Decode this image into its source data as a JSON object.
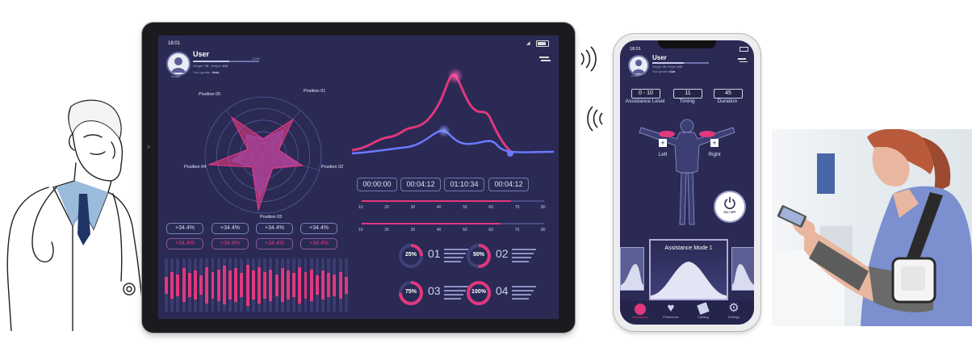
{
  "tablet": {
    "status_time": "18:01",
    "user": {
      "name": "User",
      "weight_label": "Weight:",
      "weight": "74",
      "height_label": "Height:",
      "height": "174",
      "gender_label": "Your gender:",
      "gender": "Male",
      "score": "12/50",
      "avatar_caption": "Avatar"
    },
    "radar": {
      "labels": [
        "Position 01",
        "Position 02",
        "Position 03",
        "Position 04",
        "Position 05"
      ],
      "series_blue": [
        0.55,
        0.62,
        0.75,
        0.55,
        0.45
      ],
      "series_pink": [
        0.8,
        0.7,
        0.95,
        0.95,
        0.85
      ]
    },
    "timers": [
      "00:00:00",
      "00:04:12",
      "01:10:34",
      "00:04:12"
    ],
    "slider_ticks": [
      "10",
      "20",
      "30",
      "40",
      "50",
      "60",
      "70",
      "80"
    ],
    "slider_values": [
      0.82,
      0.76
    ],
    "stats_row1": [
      "+34.4%",
      "+34.4%",
      "+34.4%",
      "+34.4%"
    ],
    "stats_row2": [
      "+34.4%",
      "+34.4%",
      "+34.4%",
      "+34.4%"
    ],
    "donuts": [
      {
        "value": "25%",
        "fraction": 0.25,
        "num": "01"
      },
      {
        "value": "50%",
        "fraction": 0.5,
        "num": "02"
      },
      {
        "value": "75%",
        "fraction": 0.75,
        "num": "03"
      },
      {
        "value": "100%",
        "fraction": 1.0,
        "num": "04"
      }
    ],
    "bar_levels": [
      0.35,
      0.55,
      0.45,
      0.7,
      0.5,
      0.6,
      0.4,
      0.75,
      0.55,
      0.65,
      0.8,
      0.6,
      0.7,
      0.5,
      0.85,
      0.6,
      0.75,
      0.55,
      0.65,
      0.45,
      0.7,
      0.6,
      0.5,
      0.75,
      0.55,
      0.65,
      0.4,
      0.6,
      0.5,
      0.45,
      0.55,
      0.35
    ]
  },
  "phone": {
    "status_time": "18:01",
    "user": {
      "name": "User",
      "weight_label": "Weight:",
      "weight": "74",
      "height_label": "Height:",
      "height": "174",
      "gender_label": "Your gender:",
      "gender": "Male",
      "avatar_caption": "Avatar"
    },
    "controls": [
      {
        "value": "0 - 10",
        "label": "Assistance Level"
      },
      {
        "value": "11",
        "label": "Timing"
      },
      {
        "value": "45",
        "label": "Duration"
      }
    ],
    "left_label": "Left",
    "right_label": "Right",
    "plus": "+",
    "power_label": "ON / OFF",
    "mode_title": "Assistance Mode 1",
    "nav": [
      "Assistance",
      "Preference",
      "Catalog",
      "Settings"
    ],
    "colors": {
      "accent": "#e0387e",
      "bg": "#2a2a55"
    }
  }
}
